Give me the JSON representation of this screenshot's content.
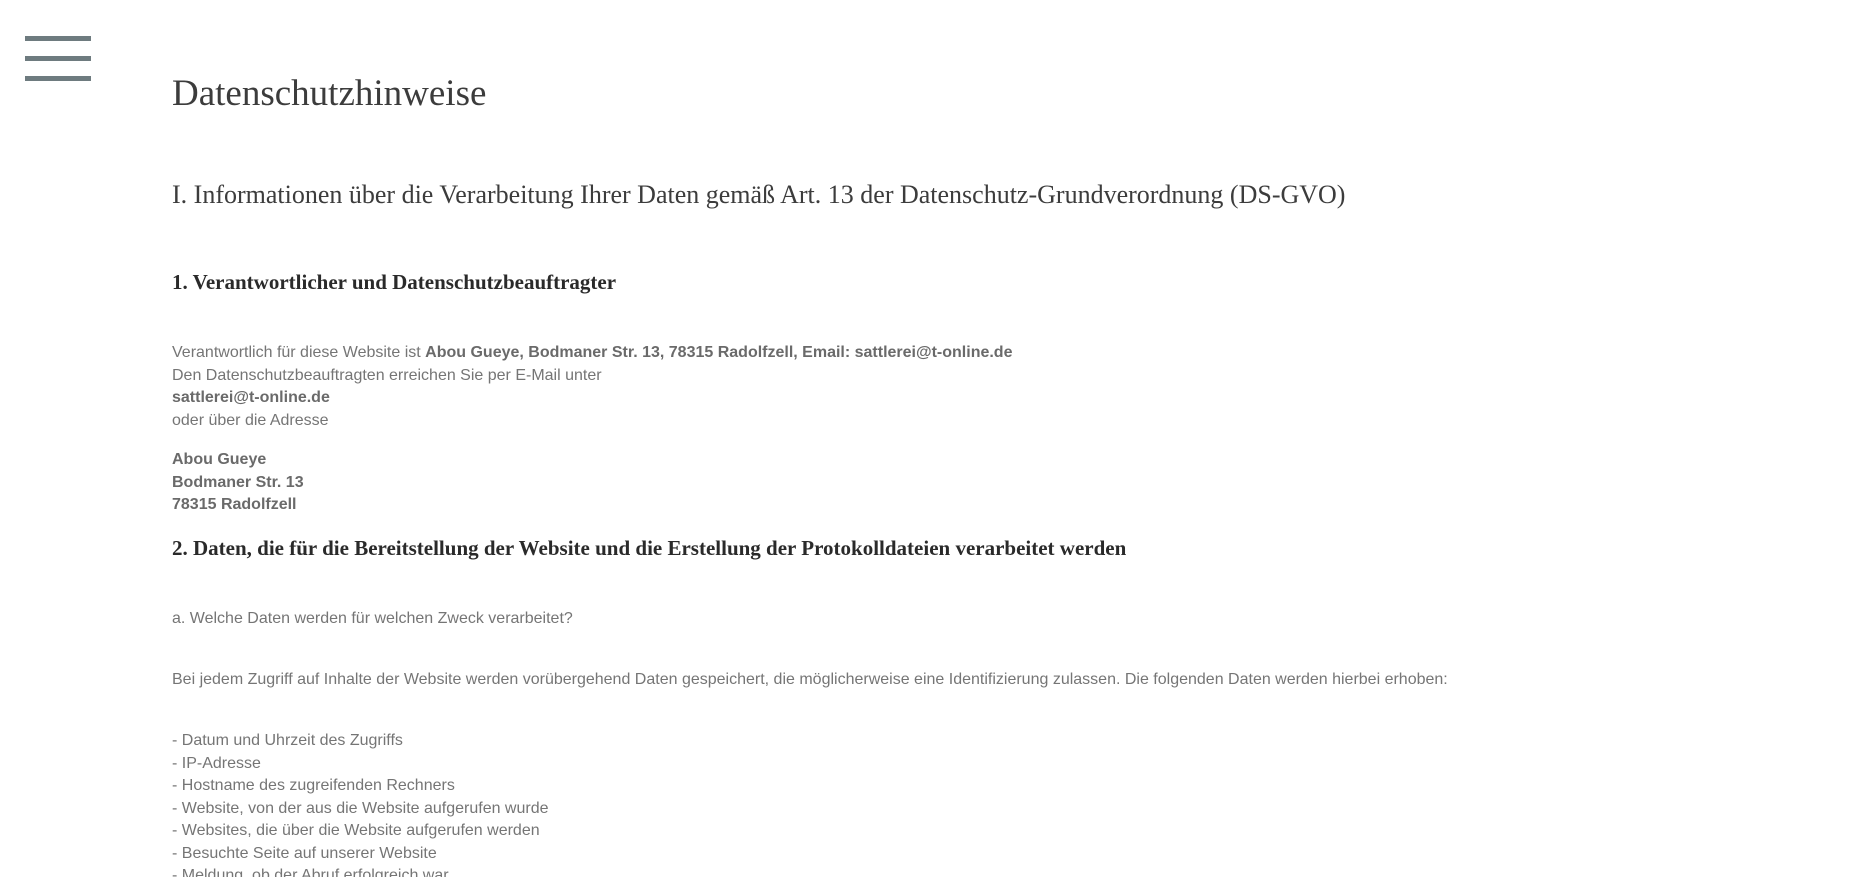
{
  "menu": {
    "icon": "hamburger-menu-icon"
  },
  "page": {
    "title": "Datenschutzhinweise",
    "section_title": "I. Informationen über die Verarbeitung Ihrer Daten gemäß Art. 13 der Datenschutz-Grundverordnung (DS-GVO)"
  },
  "s1": {
    "heading": "1. Verantwortlicher und Datenschutzbeauftragter",
    "responsible_prefix": "Verantwortlich für diese Website ist ",
    "responsible_bold": "Abou Gueye, Bodmaner Str. 13, 78315 Radolfzell,  Email: sattlerei@t-online.de",
    "dpo_line": "Den Datenschutzbeauftragten erreichen Sie per E-Mail unter",
    "dpo_email": "sattlerei@t-online.de",
    "or_address": "oder über die Adresse",
    "address": [
      "Abou Gueye",
      "Bodmaner Str. 13",
      "78315 Radolfzell"
    ]
  },
  "s2": {
    "heading": "2. Daten, die für die Bereitstellung der Website und die Erstellung der Protokolldateien verarbeitet werden",
    "question": "a. Welche Daten werden für welchen Zweck verarbeitet?",
    "intro": "Bei jedem Zugriff auf Inhalte der Website werden vorübergehend Daten gespeichert, die möglicherweise eine Identifizierung zulassen. Die folgenden Daten werden hierbei erhoben:",
    "items": [
      "- Datum und Uhrzeit des Zugriffs",
      "- IP-Adresse",
      "- Hostname des zugreifenden Rechners",
      "- Website, von der aus die Website aufgerufen wurde",
      "- Websites, die über die Website aufgerufen werden",
      "- Besuchte Seite auf unserer Website",
      "- Meldung, ob der Abruf erfolgreich war"
    ]
  }
}
